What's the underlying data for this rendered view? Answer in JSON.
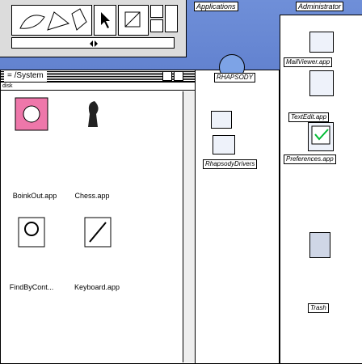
{
  "desktop": {
    "applications_label": "Applications",
    "administrator_label": "Administrator"
  },
  "system_window": {
    "title": "= /System",
    "info": "disk",
    "icons": [
      {
        "label": "BoinkOut.app",
        "icon": "boink-icon"
      },
      {
        "label": "Chess.app",
        "icon": "chess-icon"
      },
      {
        "label": "FindByCont...",
        "icon": "find-icon"
      },
      {
        "label": "Keyboard.app",
        "icon": "keyboard-icon"
      }
    ]
  },
  "middle_column": {
    "rhapsody_label": "RHAPSODY",
    "drivers_label": "RhapsodyDrivers"
  },
  "right_column": {
    "items": [
      {
        "label": "MailViewer.app",
        "icon": "mail-icon"
      },
      {
        "label": "TextEdit.app",
        "icon": "textedit-icon"
      },
      {
        "label": "Preferences.app",
        "icon": "preferences-icon"
      },
      {
        "label": "Trash",
        "icon": "trash-icon"
      }
    ]
  }
}
